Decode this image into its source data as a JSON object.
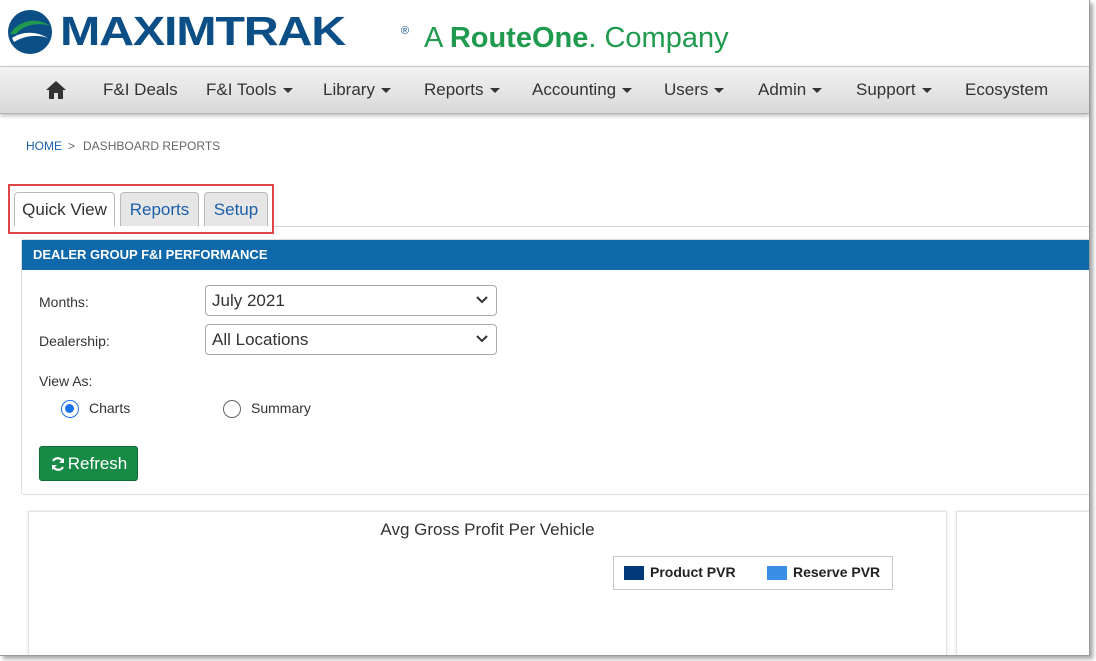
{
  "brand": {
    "name": "MAXIMTRAK",
    "registered": "®",
    "tagline_prefix": "A",
    "tagline_company": "RouteOne",
    "tagline_suffix": ". Company",
    "colors": {
      "primary_blue": "#0b4f86",
      "green": "#1f9a4e"
    }
  },
  "nav": {
    "home_icon": "home-icon",
    "items": [
      {
        "label": "F&I Deals",
        "dropdown": false
      },
      {
        "label": "F&I Tools",
        "dropdown": true
      },
      {
        "label": "Library",
        "dropdown": true
      },
      {
        "label": "Reports",
        "dropdown": true
      },
      {
        "label": "Accounting",
        "dropdown": true
      },
      {
        "label": "Users",
        "dropdown": true
      },
      {
        "label": "Admin",
        "dropdown": true
      },
      {
        "label": "Support",
        "dropdown": true
      },
      {
        "label": "Ecosystem",
        "dropdown": false
      }
    ]
  },
  "breadcrumb": {
    "home": "HOME",
    "separator": ">",
    "current": "DASHBOARD REPORTS"
  },
  "tabs": [
    {
      "label": "Quick View",
      "active": true
    },
    {
      "label": "Reports",
      "active": false
    },
    {
      "label": "Setup",
      "active": false
    }
  ],
  "panel": {
    "title": "DEALER GROUP F&I PERFORMANCE",
    "header_color": "#0f68a9",
    "months_label": "Months:",
    "months_value": "July 2021",
    "dealership_label": "Dealership:",
    "dealership_value": "All Locations",
    "view_as_label": "View As:",
    "view_options": [
      {
        "label": "Charts",
        "checked": true
      },
      {
        "label": "Summary",
        "checked": false
      }
    ],
    "refresh_label": "Refresh",
    "refresh_color": "#178a45"
  },
  "chart": {
    "title": "Avg Gross Profit Per Vehicle",
    "legend": [
      {
        "label": "Product PVR",
        "color": "#003a7a"
      },
      {
        "label": "Reserve PVR",
        "color": "#3b8ee6"
      }
    ]
  }
}
